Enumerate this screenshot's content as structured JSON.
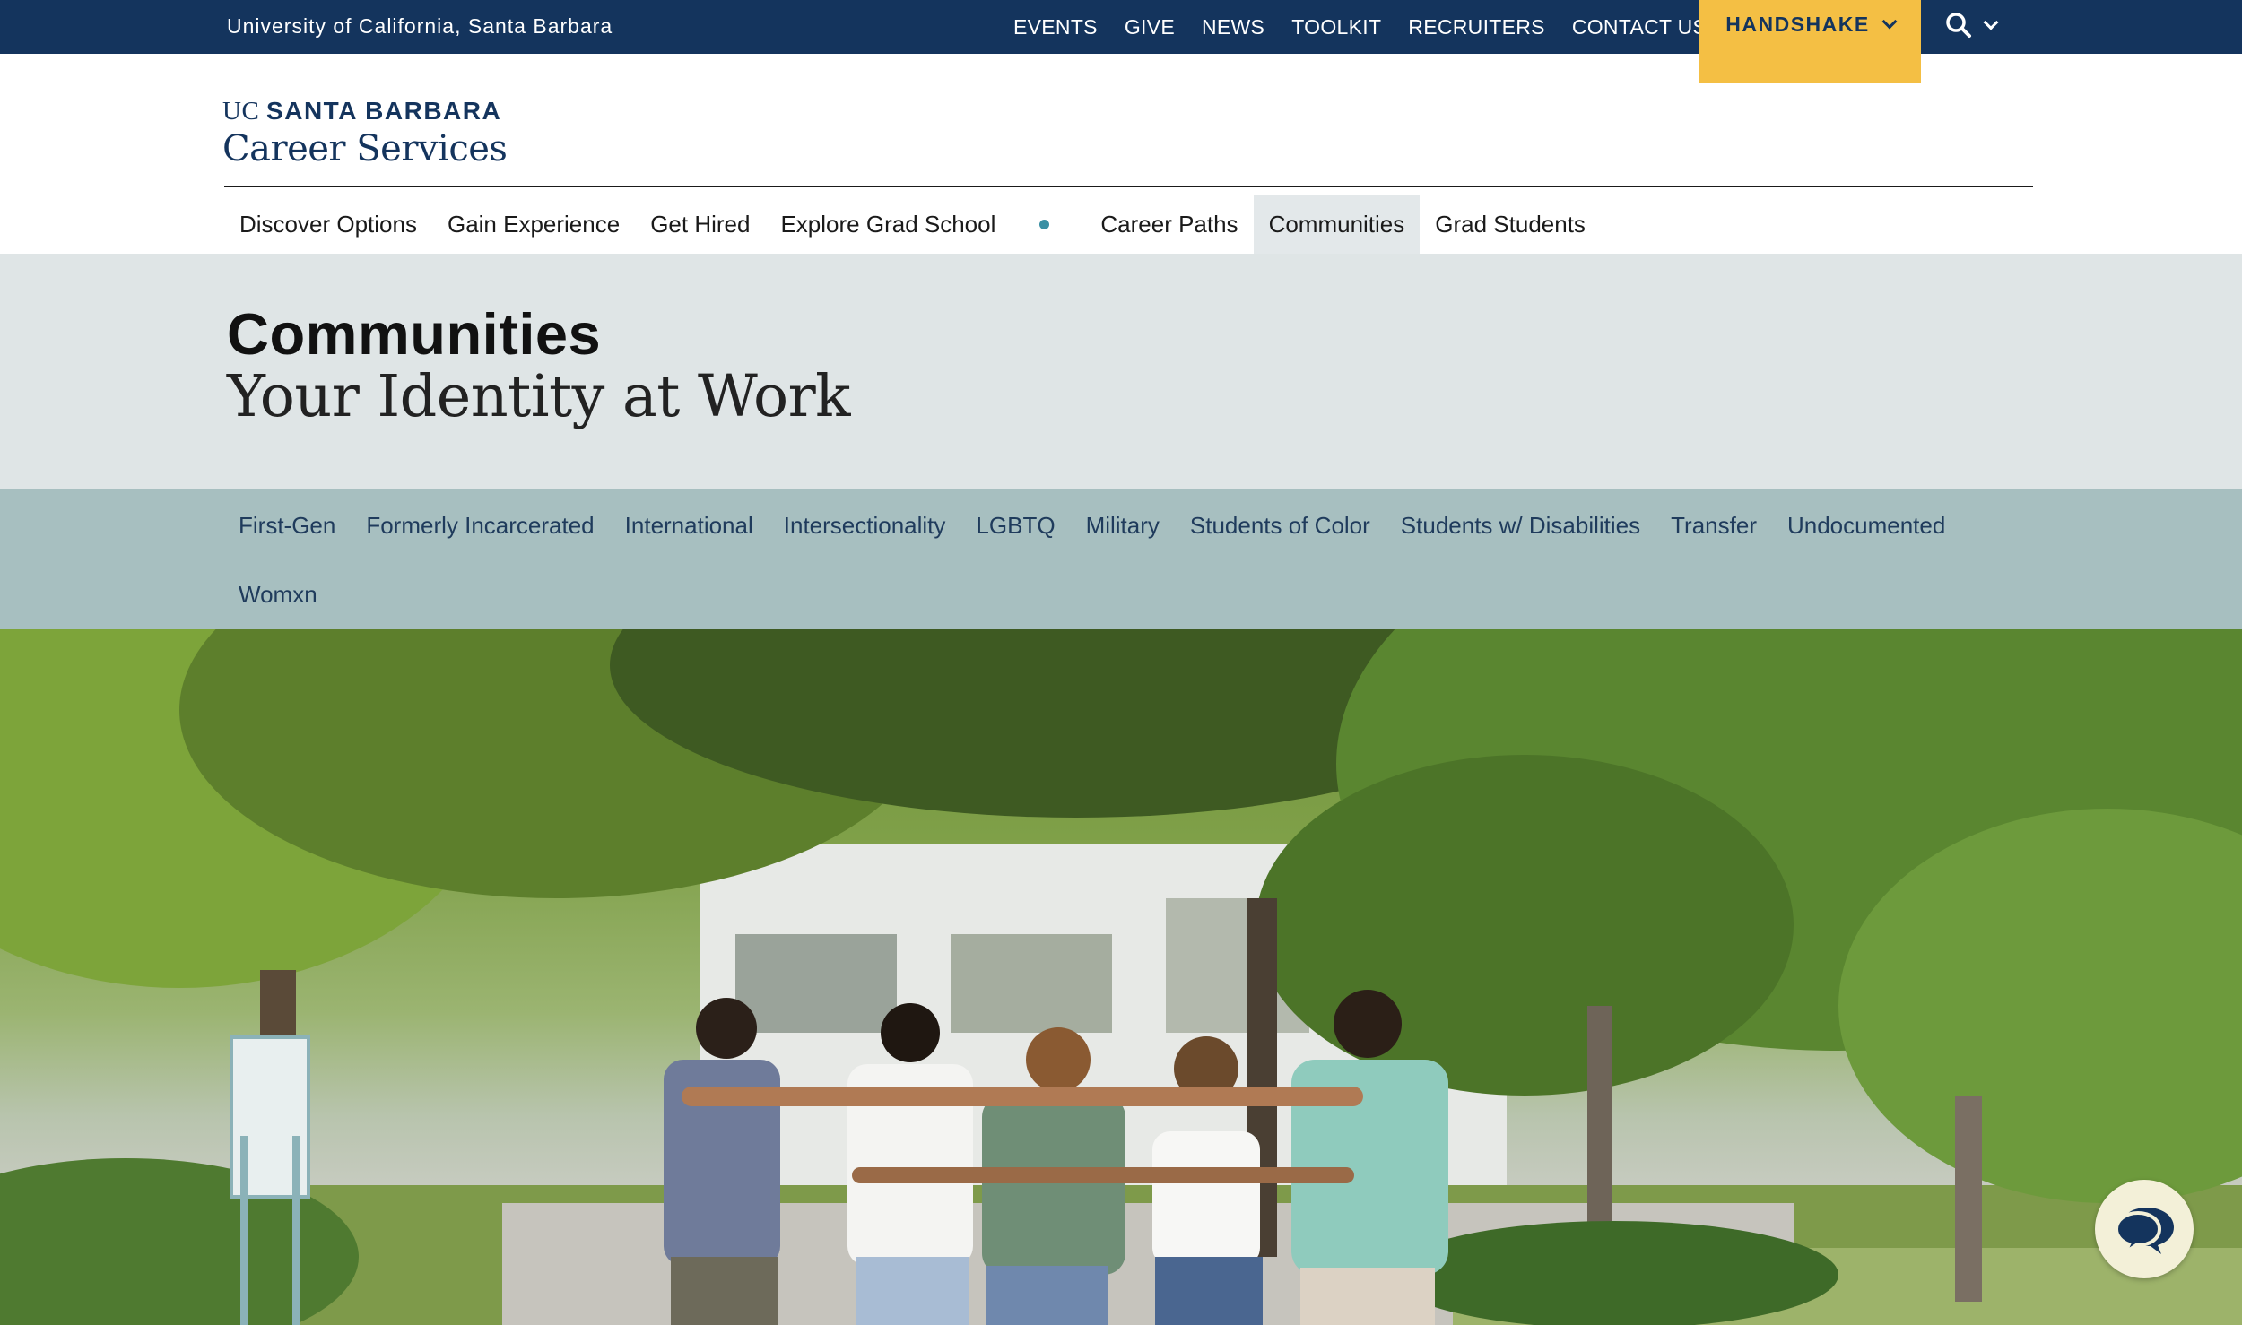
{
  "topbar": {
    "university": "University of California, Santa Barbara",
    "links": [
      "EVENTS",
      "GIVE",
      "NEWS",
      "TOOLKIT",
      "RECRUITERS"
    ],
    "contact_label": "CONTACT US",
    "handshake_label": "HANDSHAKE",
    "search_icon": "search-icon",
    "colors": {
      "bar": "#14345d",
      "handshake": "#f4bf44"
    }
  },
  "logo": {
    "uc": "UC",
    "santa_barbara": "SANTA BARBARA",
    "career_services": "Career Services"
  },
  "main_nav": {
    "items": [
      {
        "label": "Discover Options",
        "active": false
      },
      {
        "label": "Gain Experience",
        "active": false
      },
      {
        "label": "Get Hired",
        "active": false
      },
      {
        "label": "Explore Grad School",
        "active": false
      },
      {
        "label": "Career Paths",
        "active": false
      },
      {
        "label": "Communities",
        "active": true
      },
      {
        "label": "Grad Students",
        "active": false
      }
    ]
  },
  "hero_heading": {
    "title": "Communities",
    "subtitle": "Your Identity at Work"
  },
  "sub_nav": {
    "items": [
      "First-Gen",
      "Formerly Incarcerated",
      "International",
      "Intersectionality",
      "LGBTQ",
      "Military",
      "Students of Color",
      "Students w/ Disabilities",
      "Transfer",
      "Undocumented",
      "Womxn"
    ]
  },
  "chat_icon": "chat-bubbles-icon"
}
